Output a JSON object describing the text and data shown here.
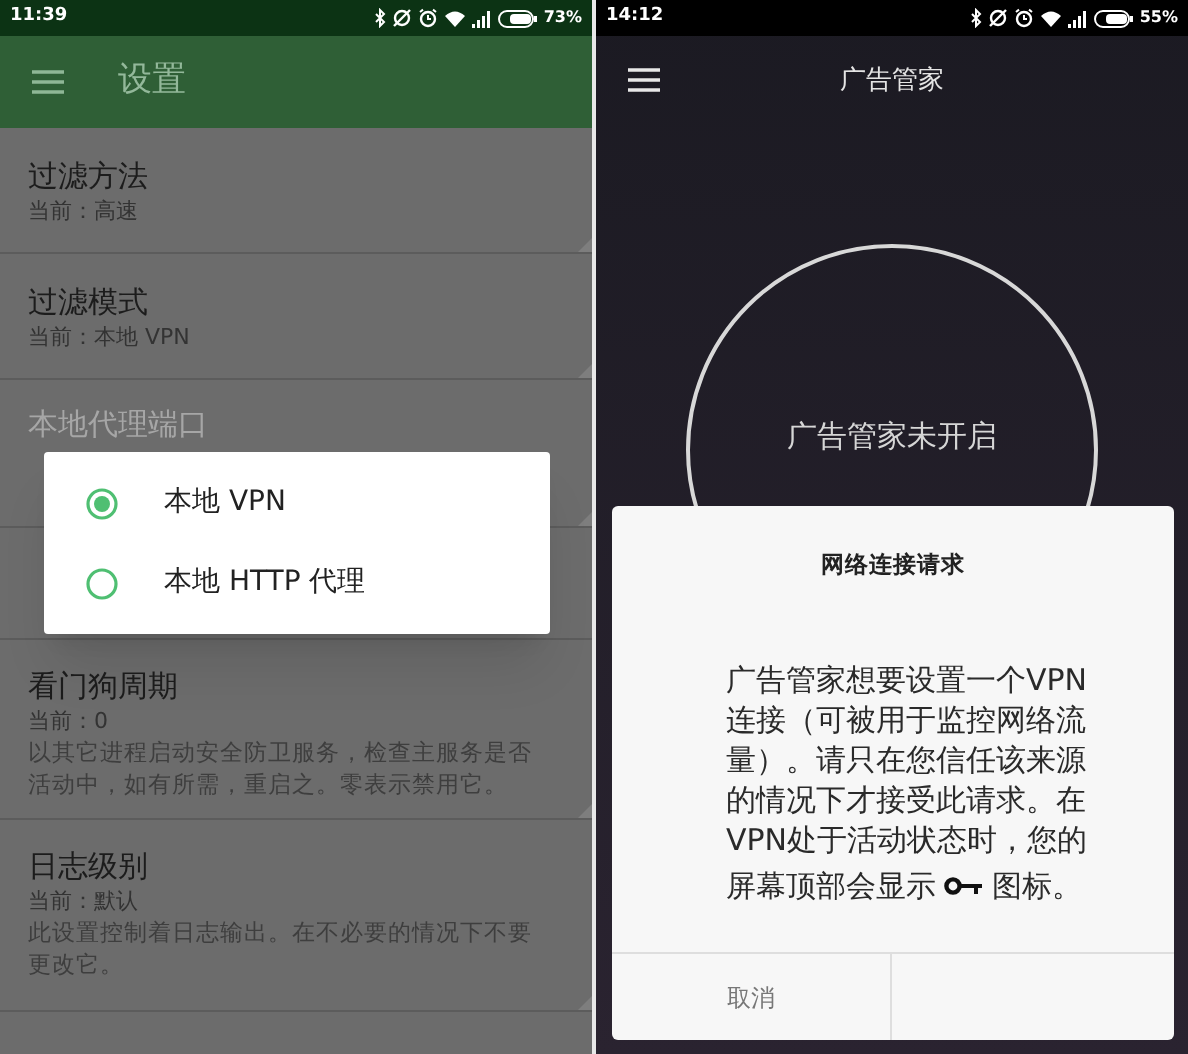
{
  "left_screen": {
    "status_bar": {
      "time": "11:39",
      "battery": "73%"
    },
    "app_bar": {
      "title": "设置"
    },
    "settings": [
      {
        "title": "过滤方法",
        "subtitle": "当前：高速",
        "disabled": false
      },
      {
        "title": "过滤模式",
        "subtitle": "当前：本地 VPN",
        "disabled": false
      },
      {
        "title": "本地代理端口",
        "disabled": true
      },
      {
        "title": "看门狗周期",
        "subtitle": "当前：0",
        "description": "以其它进程启动安全防卫服务，检查主服务是否活动中，如有所需，重启之。零表示禁用它。",
        "disabled": false
      },
      {
        "title": "日志级别",
        "subtitle": "当前：默认",
        "description": "此设置控制着日志输出。在不必要的情况下不要更改它。",
        "disabled": false
      }
    ],
    "dialog": {
      "options": [
        {
          "label": "本地 VPN",
          "selected": true
        },
        {
          "label": "本地 HTTP 代理",
          "selected": false
        }
      ]
    }
  },
  "right_screen": {
    "status_bar": {
      "time": "14:12",
      "battery": "55%"
    },
    "app_bar": {
      "title": "广告管家"
    },
    "status_circle": {
      "label": "广告管家未开启"
    },
    "dialog": {
      "title": "网络连接请求",
      "message": "广告管家想要设置一个VPN连接（可被用于监控网络流量）。请只在您信任该来源的情况下才接受此请求。在VPN处于活动状态时，您的",
      "message_before_icon": "屏幕顶部会显示",
      "message_after_icon": "图标。",
      "buttons": [
        "取消"
      ]
    }
  }
}
